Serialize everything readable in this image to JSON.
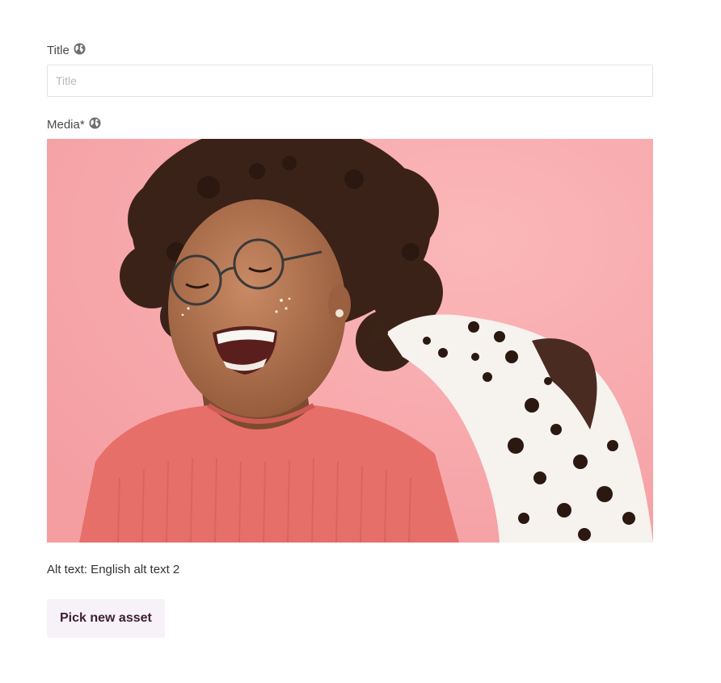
{
  "form": {
    "title_field": {
      "label": "Title",
      "placeholder": "Title",
      "value": ""
    },
    "media_field": {
      "label": "Media*",
      "image_alt": "English alt text 2",
      "alt_text_line": "Alt text: English alt text 2",
      "pick_button_label": "Pick new asset"
    },
    "icons": {
      "localized": "globe-icon"
    }
  },
  "colors": {
    "image_background": "#f7a3a6",
    "button_background": "#f7f1f8",
    "button_text": "#3d1f33",
    "input_border": "#e3e3e3"
  }
}
